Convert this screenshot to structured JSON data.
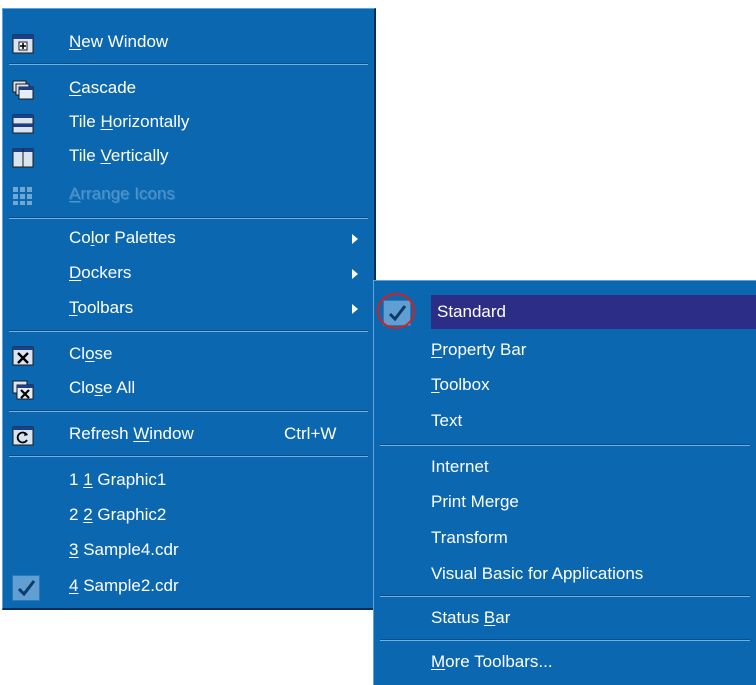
{
  "window_menu": {
    "new_window": {
      "pre": "",
      "key": "N",
      "post": "ew Window"
    },
    "cascade": {
      "pre": "",
      "key": "C",
      "post": "ascade"
    },
    "tile_horizontally": {
      "pre": "Tile ",
      "key": "H",
      "post": "orizontally"
    },
    "tile_vertically": {
      "pre": "Tile ",
      "key": "V",
      "post": "ertically"
    },
    "arrange_icons": {
      "pre": "",
      "key": "A",
      "post": "rrange Icons"
    },
    "color_palettes": {
      "pre": "Co",
      "key": "l",
      "post": "or Palettes"
    },
    "dockers": {
      "pre": "",
      "key": "D",
      "post": "ockers"
    },
    "toolbars": {
      "pre": "",
      "key": "T",
      "post": "oolbars"
    },
    "close": {
      "pre": "Cl",
      "key": "o",
      "post": "se"
    },
    "close_all": {
      "pre": "Clo",
      "key": "s",
      "post": "e All"
    },
    "refresh_window": {
      "pre": "Refresh ",
      "key": "W",
      "post": "indow",
      "shortcut": "Ctrl+W"
    },
    "docs": [
      {
        "pre": "1 ",
        "key": "1",
        "post": " Graphic1"
      },
      {
        "pre": "2 ",
        "key": "2",
        "post": " Graphic2"
      },
      {
        "pre": "",
        "key": "3",
        "post": " Sample4.cdr"
      },
      {
        "pre": "",
        "key": "4",
        "post": " Sample2.cdr"
      }
    ]
  },
  "toolbars_submenu": {
    "standard": {
      "pre": "Standard",
      "key": "",
      "post": ""
    },
    "property_bar": {
      "pre": "",
      "key": "P",
      "post": "roperty Bar"
    },
    "toolbox": {
      "pre": "",
      "key": "T",
      "post": "oolbox"
    },
    "text": {
      "pre": "Text",
      "key": "",
      "post": ""
    },
    "internet": {
      "pre": "Internet",
      "key": "",
      "post": ""
    },
    "print_merge": {
      "pre": "Print Merge",
      "key": "",
      "post": ""
    },
    "transform": {
      "pre": "Transform",
      "key": "",
      "post": ""
    },
    "vba": {
      "pre": "Visual Basic for Applications",
      "key": "",
      "post": ""
    },
    "status_bar": {
      "pre": "Status ",
      "key": "B",
      "post": "ar"
    },
    "more_toolbars": {
      "pre": "",
      "key": "M",
      "post": "ore Toolbars..."
    }
  },
  "colors": {
    "menu_bg": "#0b67b0",
    "selected_bg": "#2b2d86",
    "highlight_ring": "#d42020"
  }
}
